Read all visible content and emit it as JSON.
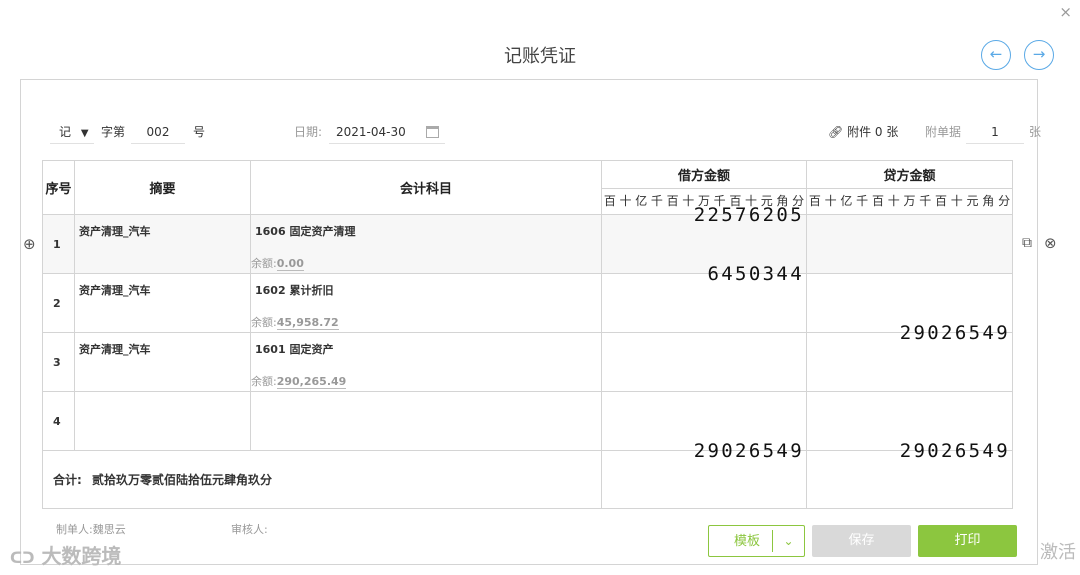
{
  "dialog": {
    "title": "记账凭证",
    "close": "×",
    "prev": "←",
    "next": "→"
  },
  "header": {
    "voucher_word": "记",
    "word_label": "字第",
    "number": "002",
    "number_suffix": "号",
    "date_label": "日期:",
    "date_value": "2021-04-30",
    "attachment_label": "附件 0 张",
    "doc_count_label": "附单据",
    "doc_count": "1",
    "doc_count_suffix": "张"
  },
  "table": {
    "col_seq": "序号",
    "col_summary": "摘要",
    "col_account": "会计科目",
    "col_debit": "借方金额",
    "col_credit": "贷方金额",
    "units": [
      "百",
      "十",
      "亿",
      "千",
      "百",
      "十",
      "万",
      "千",
      "百",
      "十",
      "元",
      "角",
      "分"
    ],
    "rows": [
      {
        "seq": "1",
        "summary": "资产清理_汽车",
        "account": "1606 固定资产清理",
        "balance_label": "余额:",
        "balance": "0.00",
        "debit": "22576205",
        "credit": ""
      },
      {
        "seq": "2",
        "summary": "资产清理_汽车",
        "account": "1602 累计折旧",
        "balance_label": "余额:",
        "balance": "45,958.72",
        "debit": "6450344",
        "credit": ""
      },
      {
        "seq": "3",
        "summary": "资产清理_汽车",
        "account": "1601 固定资产",
        "balance_label": "余额:",
        "balance": "290,265.49",
        "debit": "",
        "credit": "29026549"
      },
      {
        "seq": "4",
        "summary": "",
        "account": "",
        "balance_label": "",
        "balance": "",
        "debit": "",
        "credit": ""
      }
    ],
    "total_label": "合计:",
    "total_words": "贰拾玖万零贰佰陆拾伍元肆角玖分",
    "total_debit": "29026549",
    "total_credit": "29026549"
  },
  "footer": {
    "maker_label": "制单人:",
    "maker": "魏思云",
    "reviewer_label": "审核人:",
    "template_button": "模板",
    "save_button": "保存",
    "print_button": "打印"
  },
  "watermark": {
    "text": "大数跨境",
    "activate": "激活"
  },
  "colors": {
    "accent_green": "#8cc63f",
    "nav_blue": "#5aa9e6",
    "disabled_gray": "#d9d9d9"
  }
}
